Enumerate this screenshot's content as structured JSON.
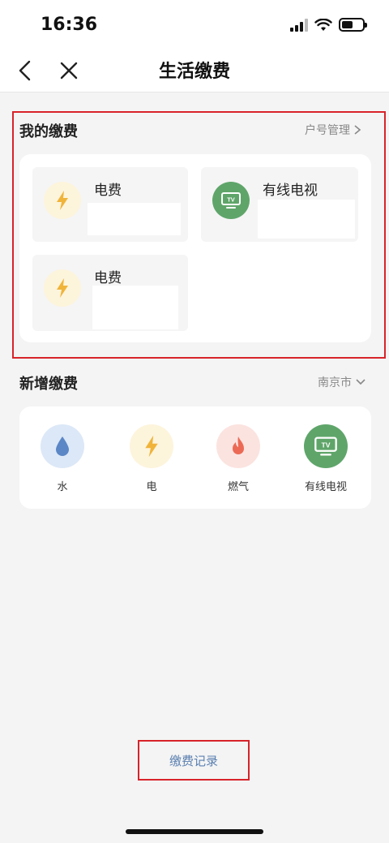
{
  "status_bar": {
    "time": "16:36"
  },
  "nav": {
    "title": "生活缴费"
  },
  "my_bills": {
    "title": "我的缴费",
    "manage_link": "户号管理",
    "items": [
      {
        "name": "电费",
        "icon": "bolt-icon"
      },
      {
        "name": "有线电视",
        "icon": "tv-icon"
      },
      {
        "name": "电费",
        "icon": "bolt-icon"
      }
    ]
  },
  "new_bills": {
    "title": "新增缴费",
    "city": "南京市",
    "items": [
      {
        "label": "水",
        "icon": "water-drop-icon",
        "bg": "#dce8f7",
        "fg": "#5b87c6"
      },
      {
        "label": "电",
        "icon": "bolt-icon",
        "bg": "#fdf4dc",
        "fg": "#f0b43a"
      },
      {
        "label": "燃气",
        "icon": "flame-icon",
        "bg": "#fbe3e0",
        "fg": "#ec6a55"
      },
      {
        "label": "有线电视",
        "icon": "tv-icon",
        "bg": "#5fa56a",
        "fg": "#ffffff"
      }
    ]
  },
  "footer": {
    "records_link": "缴费记录"
  },
  "colors": {
    "highlight": "#d8232a",
    "link": "#5a7fb0"
  }
}
